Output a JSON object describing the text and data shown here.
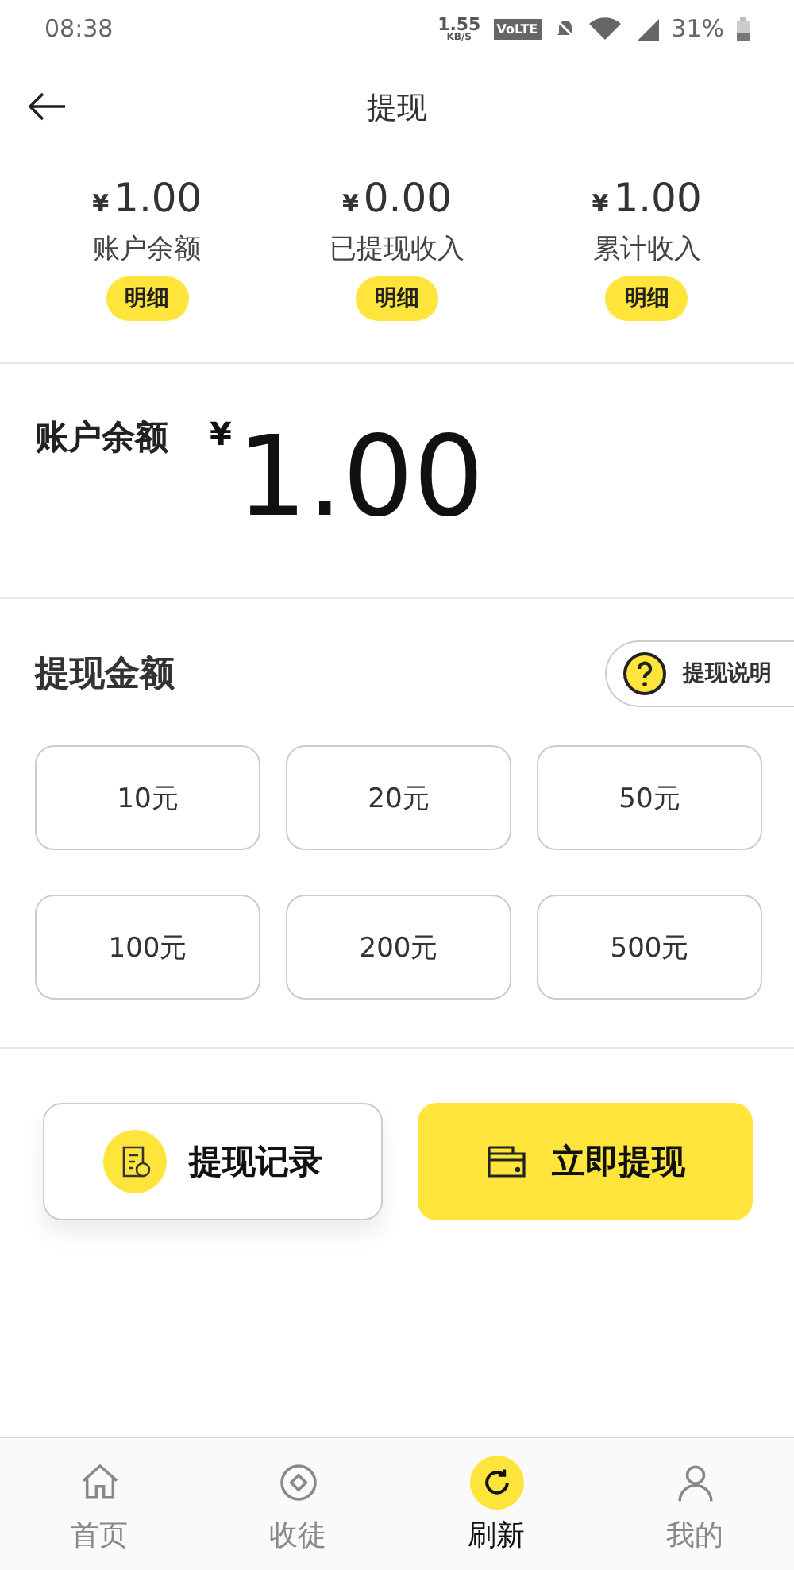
{
  "status_bar": {
    "time": "08:38",
    "speed": "1.55",
    "speed_unit": "KB/S",
    "network_badge": "VoLTE",
    "battery": "31%"
  },
  "header": {
    "title": "提现"
  },
  "stats": [
    {
      "currency": "¥",
      "amount": "1.00",
      "label": "账户余额",
      "button": "明细"
    },
    {
      "currency": "¥",
      "amount": "0.00",
      "label": "已提现收入",
      "button": "明细"
    },
    {
      "currency": "¥",
      "amount": "1.00",
      "label": "累计收入",
      "button": "明细"
    }
  ],
  "balance": {
    "label": "账户余额",
    "currency": "¥",
    "amount": "1.00"
  },
  "withdraw": {
    "title": "提现金额",
    "help_button": "提现说明",
    "options": [
      {
        "label": "10元",
        "selected": false
      },
      {
        "label": "20元",
        "selected": false
      },
      {
        "label": "50元",
        "selected": false
      },
      {
        "label": "100元",
        "selected": false
      },
      {
        "label": "200元",
        "selected": false
      },
      {
        "label": "500元",
        "selected": false
      }
    ]
  },
  "actions": [
    {
      "kind": "records",
      "label": "提现记录"
    },
    {
      "kind": "withdraw",
      "label": "立即提现"
    }
  ],
  "tab_bar": [
    {
      "kind": "home",
      "label": "首页",
      "selected": false
    },
    {
      "kind": "apprentice",
      "label": "收徒",
      "selected": false
    },
    {
      "kind": "refresh",
      "label": "刷新",
      "selected": true
    },
    {
      "kind": "me",
      "label": "我的",
      "selected": false
    }
  ]
}
